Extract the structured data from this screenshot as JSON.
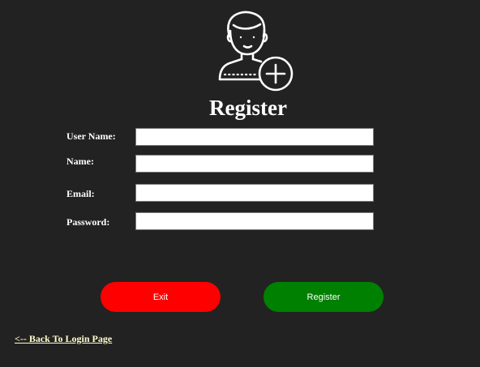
{
  "form": {
    "title": "Register",
    "fields": [
      {
        "label": "User Name:",
        "value": "",
        "placeholder": ""
      },
      {
        "label": "Name:",
        "value": "",
        "placeholder": ""
      },
      {
        "label": "Email:",
        "value": "",
        "placeholder": ""
      },
      {
        "label": "Password:",
        "value": "",
        "placeholder": ""
      }
    ]
  },
  "buttons": {
    "exit_label": "Exit",
    "register_label": "Register"
  },
  "back_link": {
    "label": "<-- Back To Login Page"
  },
  "header_icon": "add-user-icon",
  "colors": {
    "background": "#222222",
    "exit_button": "#ff0000",
    "register_button": "#008000",
    "link": "#ffffcc",
    "text": "#ffffff"
  }
}
